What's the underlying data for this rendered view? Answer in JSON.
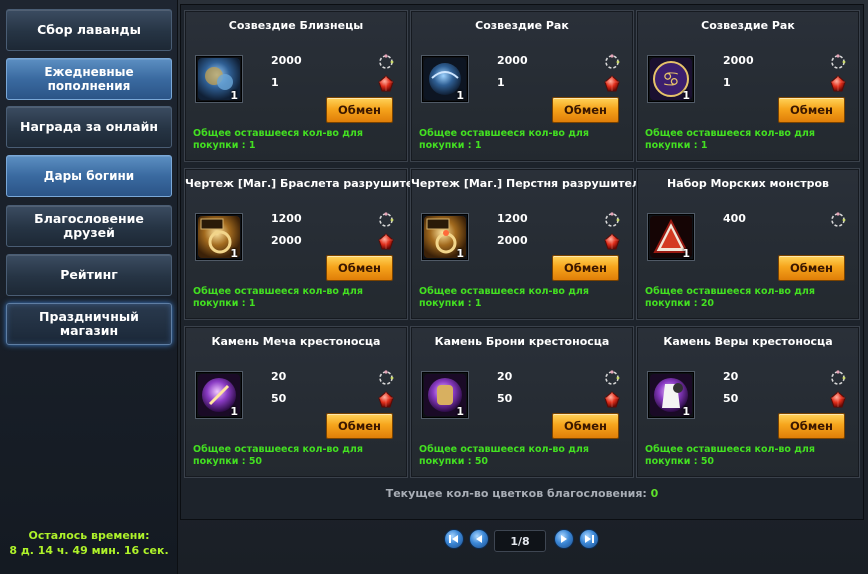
{
  "sidebar": {
    "items": [
      {
        "label": "Сбор лаванды"
      },
      {
        "label": "Ежедневные пополнения"
      },
      {
        "label": "Награда за онлайн"
      },
      {
        "label": "Дары богини"
      },
      {
        "label": "Благословение друзей"
      },
      {
        "label": "Рейтинг"
      },
      {
        "label": "Праздничный магазин"
      }
    ],
    "timer_label": "Осталось времени:",
    "timer_value": "8 д. 14 ч. 49 мин. 16 сек."
  },
  "cards": [
    {
      "title": "Созвездие Близнецы",
      "count": "1",
      "icon": "gemini-constellation-icon",
      "costs": [
        "2000",
        "1"
      ],
      "button": "Обмен",
      "remaining": "Общее оставшееся кол-во для покупки : 1"
    },
    {
      "title": "Созвездие Рак",
      "count": "1",
      "icon": "crab-constellation-icon",
      "costs": [
        "2000",
        "1"
      ],
      "button": "Обмен",
      "remaining": "Общее оставшееся кол-во для покупки : 1"
    },
    {
      "title": "Созвездие Рак",
      "count": "1",
      "icon": "cancer-sign-icon",
      "costs": [
        "2000",
        "1"
      ],
      "button": "Обмен",
      "remaining": "Общее оставшееся кол-во для покупки : 1"
    },
    {
      "title": "Чертеж [Маг.] Браслета разрушителя",
      "count": "1",
      "icon": "bracelet-blueprint-icon",
      "costs": [
        "1200",
        "2000"
      ],
      "button": "Обмен",
      "remaining": "Общее оставшееся кол-во для покупки : 1"
    },
    {
      "title": "Чертеж [Маг.] Перстня разрушителя",
      "count": "1",
      "icon": "ring-blueprint-icon",
      "costs": [
        "1200",
        "2000"
      ],
      "button": "Обмен",
      "remaining": "Общее оставшееся кол-во для покупки : 1"
    },
    {
      "title": "Набор Морских монстров",
      "count": "1",
      "icon": "sea-monster-set-icon",
      "costs": [
        "400"
      ],
      "button": "Обмен",
      "remaining": "Общее оставшееся кол-во для покупки : 20"
    },
    {
      "title": "Камень Меча крестоносца",
      "count": "1",
      "icon": "sword-stone-icon",
      "costs": [
        "20",
        "50"
      ],
      "button": "Обмен",
      "remaining": "Общее оставшееся кол-во для покупки : 50"
    },
    {
      "title": "Камень Брони крестоносца",
      "count": "1",
      "icon": "armor-stone-icon",
      "costs": [
        "20",
        "50"
      ],
      "button": "Обмен",
      "remaining": "Общее оставшееся кол-во для покупки : 50"
    },
    {
      "title": "Камень Веры крестоносца",
      "count": "1",
      "icon": "faith-stone-icon",
      "costs": [
        "20",
        "50"
      ],
      "button": "Обмен",
      "remaining": "Общее оставшееся кол-во для покупки : 50"
    }
  ],
  "currency_icons": [
    "flower-wreath-icon",
    "red-gem-icon"
  ],
  "footer": {
    "blessing_label": "Текущее кол-во цветков благословения:",
    "blessing_value": "0",
    "page": "1/8"
  },
  "colors": {
    "accent_green": "#43e021",
    "button_orange": "#f6a51c",
    "timer_green": "#aef22a"
  }
}
